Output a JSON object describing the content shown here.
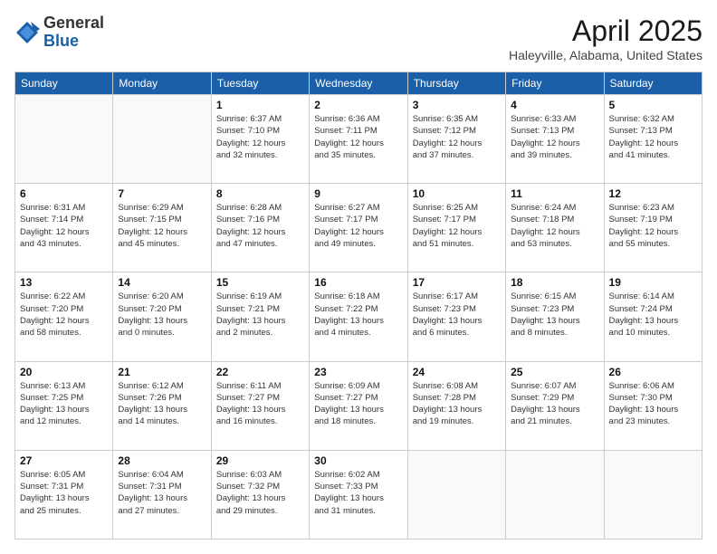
{
  "header": {
    "logo_general": "General",
    "logo_blue": "Blue",
    "month_title": "April 2025",
    "location": "Haleyville, Alabama, United States"
  },
  "weekdays": [
    "Sunday",
    "Monday",
    "Tuesday",
    "Wednesday",
    "Thursday",
    "Friday",
    "Saturday"
  ],
  "weeks": [
    [
      {
        "day": "",
        "detail": ""
      },
      {
        "day": "",
        "detail": ""
      },
      {
        "day": "1",
        "detail": "Sunrise: 6:37 AM\nSunset: 7:10 PM\nDaylight: 12 hours\nand 32 minutes."
      },
      {
        "day": "2",
        "detail": "Sunrise: 6:36 AM\nSunset: 7:11 PM\nDaylight: 12 hours\nand 35 minutes."
      },
      {
        "day": "3",
        "detail": "Sunrise: 6:35 AM\nSunset: 7:12 PM\nDaylight: 12 hours\nand 37 minutes."
      },
      {
        "day": "4",
        "detail": "Sunrise: 6:33 AM\nSunset: 7:13 PM\nDaylight: 12 hours\nand 39 minutes."
      },
      {
        "day": "5",
        "detail": "Sunrise: 6:32 AM\nSunset: 7:13 PM\nDaylight: 12 hours\nand 41 minutes."
      }
    ],
    [
      {
        "day": "6",
        "detail": "Sunrise: 6:31 AM\nSunset: 7:14 PM\nDaylight: 12 hours\nand 43 minutes."
      },
      {
        "day": "7",
        "detail": "Sunrise: 6:29 AM\nSunset: 7:15 PM\nDaylight: 12 hours\nand 45 minutes."
      },
      {
        "day": "8",
        "detail": "Sunrise: 6:28 AM\nSunset: 7:16 PM\nDaylight: 12 hours\nand 47 minutes."
      },
      {
        "day": "9",
        "detail": "Sunrise: 6:27 AM\nSunset: 7:17 PM\nDaylight: 12 hours\nand 49 minutes."
      },
      {
        "day": "10",
        "detail": "Sunrise: 6:25 AM\nSunset: 7:17 PM\nDaylight: 12 hours\nand 51 minutes."
      },
      {
        "day": "11",
        "detail": "Sunrise: 6:24 AM\nSunset: 7:18 PM\nDaylight: 12 hours\nand 53 minutes."
      },
      {
        "day": "12",
        "detail": "Sunrise: 6:23 AM\nSunset: 7:19 PM\nDaylight: 12 hours\nand 55 minutes."
      }
    ],
    [
      {
        "day": "13",
        "detail": "Sunrise: 6:22 AM\nSunset: 7:20 PM\nDaylight: 12 hours\nand 58 minutes."
      },
      {
        "day": "14",
        "detail": "Sunrise: 6:20 AM\nSunset: 7:20 PM\nDaylight: 13 hours\nand 0 minutes."
      },
      {
        "day": "15",
        "detail": "Sunrise: 6:19 AM\nSunset: 7:21 PM\nDaylight: 13 hours\nand 2 minutes."
      },
      {
        "day": "16",
        "detail": "Sunrise: 6:18 AM\nSunset: 7:22 PM\nDaylight: 13 hours\nand 4 minutes."
      },
      {
        "day": "17",
        "detail": "Sunrise: 6:17 AM\nSunset: 7:23 PM\nDaylight: 13 hours\nand 6 minutes."
      },
      {
        "day": "18",
        "detail": "Sunrise: 6:15 AM\nSunset: 7:23 PM\nDaylight: 13 hours\nand 8 minutes."
      },
      {
        "day": "19",
        "detail": "Sunrise: 6:14 AM\nSunset: 7:24 PM\nDaylight: 13 hours\nand 10 minutes."
      }
    ],
    [
      {
        "day": "20",
        "detail": "Sunrise: 6:13 AM\nSunset: 7:25 PM\nDaylight: 13 hours\nand 12 minutes."
      },
      {
        "day": "21",
        "detail": "Sunrise: 6:12 AM\nSunset: 7:26 PM\nDaylight: 13 hours\nand 14 minutes."
      },
      {
        "day": "22",
        "detail": "Sunrise: 6:11 AM\nSunset: 7:27 PM\nDaylight: 13 hours\nand 16 minutes."
      },
      {
        "day": "23",
        "detail": "Sunrise: 6:09 AM\nSunset: 7:27 PM\nDaylight: 13 hours\nand 18 minutes."
      },
      {
        "day": "24",
        "detail": "Sunrise: 6:08 AM\nSunset: 7:28 PM\nDaylight: 13 hours\nand 19 minutes."
      },
      {
        "day": "25",
        "detail": "Sunrise: 6:07 AM\nSunset: 7:29 PM\nDaylight: 13 hours\nand 21 minutes."
      },
      {
        "day": "26",
        "detail": "Sunrise: 6:06 AM\nSunset: 7:30 PM\nDaylight: 13 hours\nand 23 minutes."
      }
    ],
    [
      {
        "day": "27",
        "detail": "Sunrise: 6:05 AM\nSunset: 7:31 PM\nDaylight: 13 hours\nand 25 minutes."
      },
      {
        "day": "28",
        "detail": "Sunrise: 6:04 AM\nSunset: 7:31 PM\nDaylight: 13 hours\nand 27 minutes."
      },
      {
        "day": "29",
        "detail": "Sunrise: 6:03 AM\nSunset: 7:32 PM\nDaylight: 13 hours\nand 29 minutes."
      },
      {
        "day": "30",
        "detail": "Sunrise: 6:02 AM\nSunset: 7:33 PM\nDaylight: 13 hours\nand 31 minutes."
      },
      {
        "day": "",
        "detail": ""
      },
      {
        "day": "",
        "detail": ""
      },
      {
        "day": "",
        "detail": ""
      }
    ]
  ]
}
